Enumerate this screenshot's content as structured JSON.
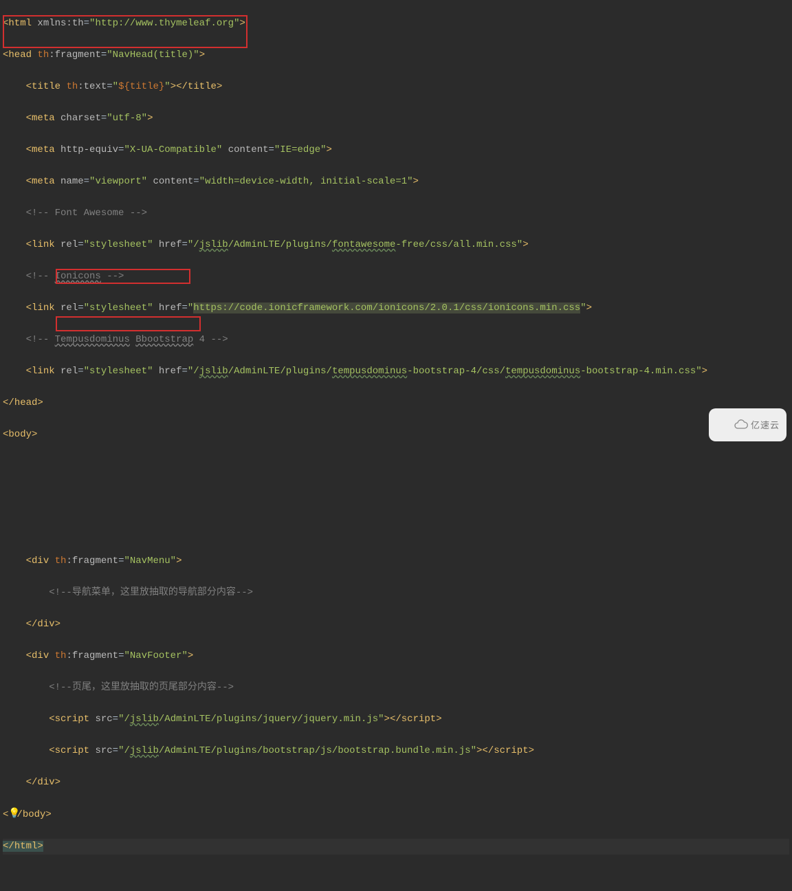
{
  "watermark": "亿速云",
  "hints": {
    "bulb": "💡"
  },
  "code": {
    "l1": {
      "p1": "<",
      "p2": "html ",
      "p3": "xmlns:th",
      "p4": "=",
      "p5": "\"http://www.thymeleaf.org\"",
      "p6": ">"
    },
    "l2": {
      "p1": "<",
      "p2": "head ",
      "p3": "th",
      "p4": ":fragment",
      "p5": "=",
      "p6": "\"NavHead(title)\"",
      "p7": ">"
    },
    "l3": {
      "ind": "    ",
      "p1": "<",
      "p2": "title ",
      "p3": "th",
      "p4": ":text",
      "p5": "=",
      "p6": "\"",
      "p7": "${title}",
      "p8": "\"",
      "p9": "></",
      "p10": "title",
      "p11": ">"
    },
    "l4": {
      "ind": "    ",
      "p1": "<",
      "p2": "meta ",
      "p3": "charset",
      "p4": "=",
      "p5": "\"utf-8\"",
      "p6": ">"
    },
    "l5": {
      "ind": "    ",
      "p1": "<",
      "p2": "meta ",
      "p3": "http-equiv",
      "p4": "=",
      "p5": "\"X-UA-Compatible\" ",
      "p6": "content",
      "p7": "=",
      "p8": "\"IE=edge\"",
      "p9": ">"
    },
    "l6": {
      "ind": "    ",
      "p1": "<",
      "p2": "meta ",
      "p3": "name",
      "p4": "=",
      "p5": "\"viewport\" ",
      "p6": "content",
      "p7": "=",
      "p8": "\"width=device-width, initial-scale=1\"",
      "p9": ">"
    },
    "l7": {
      "ind": "    ",
      "p1": "<!-- Font Awesome -->"
    },
    "l8": {
      "ind": "    ",
      "p1": "<",
      "p2": "link ",
      "p3": "rel",
      "p4": "=",
      "p5": "\"stylesheet\" ",
      "p6": "href",
      "p7": "=",
      "p8": "\"/",
      "p9": "jslib",
      "p10": "/AdminLTE/plugins/",
      "p11": "fontawesome",
      "p12": "-free/css/all.min.css\"",
      "p13": ">"
    },
    "l9": {
      "ind": "    ",
      "p1": "<!-- ",
      "p2": "Ionicons",
      "p3": " -->"
    },
    "l10": {
      "ind": "    ",
      "p1": "<",
      "p2": "link ",
      "p3": "rel",
      "p4": "=",
      "p5": "\"stylesheet\" ",
      "p6": "href",
      "p7": "=",
      "p8": "\"",
      "p9": "https://code.ionicframework.com/ionicons/2.0.1/css/ionicons.min.css",
      "p10": "\"",
      "p11": ">"
    },
    "l11": {
      "ind": "    ",
      "p1": "<!-- ",
      "p2": "Tempusdominus",
      "p3": " ",
      "p4": "Bbootstrap",
      "p5": " 4 -->"
    },
    "l12": {
      "ind": "    ",
      "p1": "<",
      "p2": "link ",
      "p3": "rel",
      "p4": "=",
      "p5": "\"stylesheet\" ",
      "p6": "href",
      "p7": "=",
      "p8": "\"/",
      "p9": "jslib",
      "p10": "/AdminLTE/plugins/",
      "p11": "tempusdominus",
      "p12": "-bootstrap-4/css/",
      "p13": "tempusdominus",
      "p14": "-bootstrap-4.min.css\"",
      "p15": ">"
    },
    "l13": {
      "p1": "</",
      "p2": "head",
      "p3": ">"
    },
    "l14": {
      "p1": "<",
      "p2": "body",
      "p3": ">"
    },
    "l15": {
      "p1": ""
    },
    "l16": {
      "p1": ""
    },
    "l17": {
      "p1": ""
    },
    "l18": {
      "ind": "    ",
      "p1": "<",
      "p2": "div ",
      "p3": "th",
      "p4": ":fragment",
      "p5": "=",
      "p6": "\"NavMenu\"",
      "p7": ">"
    },
    "l19": {
      "ind": "        ",
      "p1": "<!--导航菜单，这里放抽取的导航部分内容-->"
    },
    "l20": {
      "ind": "    ",
      "p1": "</",
      "p2": "div",
      "p3": ">"
    },
    "l21": {
      "ind": "    ",
      "p1": "<",
      "p2": "div ",
      "p3": "th",
      "p4": ":fragment",
      "p5": "=",
      "p6": "\"NavFooter\"",
      "p7": ">"
    },
    "l22": {
      "ind": "        ",
      "p1": "<!--页尾，这里放抽取的页尾部分内容-->"
    },
    "l23": {
      "ind": "        ",
      "p1": "<",
      "p2": "script ",
      "p3": "src",
      "p4": "=",
      "p5": "\"/",
      "p6": "jslib",
      "p7": "/AdminLTE/plugins/jquery/jquery.min.js\"",
      "p8": "></",
      "p9": "script",
      "p10": ">"
    },
    "l24": {
      "ind": "        ",
      "p1": "<",
      "p2": "script ",
      "p3": "src",
      "p4": "=",
      "p5": "\"/",
      "p6": "jslib",
      "p7": "/AdminLTE/plugins/bootstrap/js/bootstrap.bundle.min.js\"",
      "p8": "></",
      "p9": "script",
      "p10": ">"
    },
    "l25": {
      "ind": "    ",
      "p1": "</",
      "p2": "div",
      "p3": ">"
    },
    "l26": {
      "ind": "<",
      "icon": "💡",
      "p1": "/",
      "p2": "body",
      "p3": ">"
    },
    "l27": {
      "p1": "</",
      "p2": "html",
      "p3": ">"
    }
  }
}
